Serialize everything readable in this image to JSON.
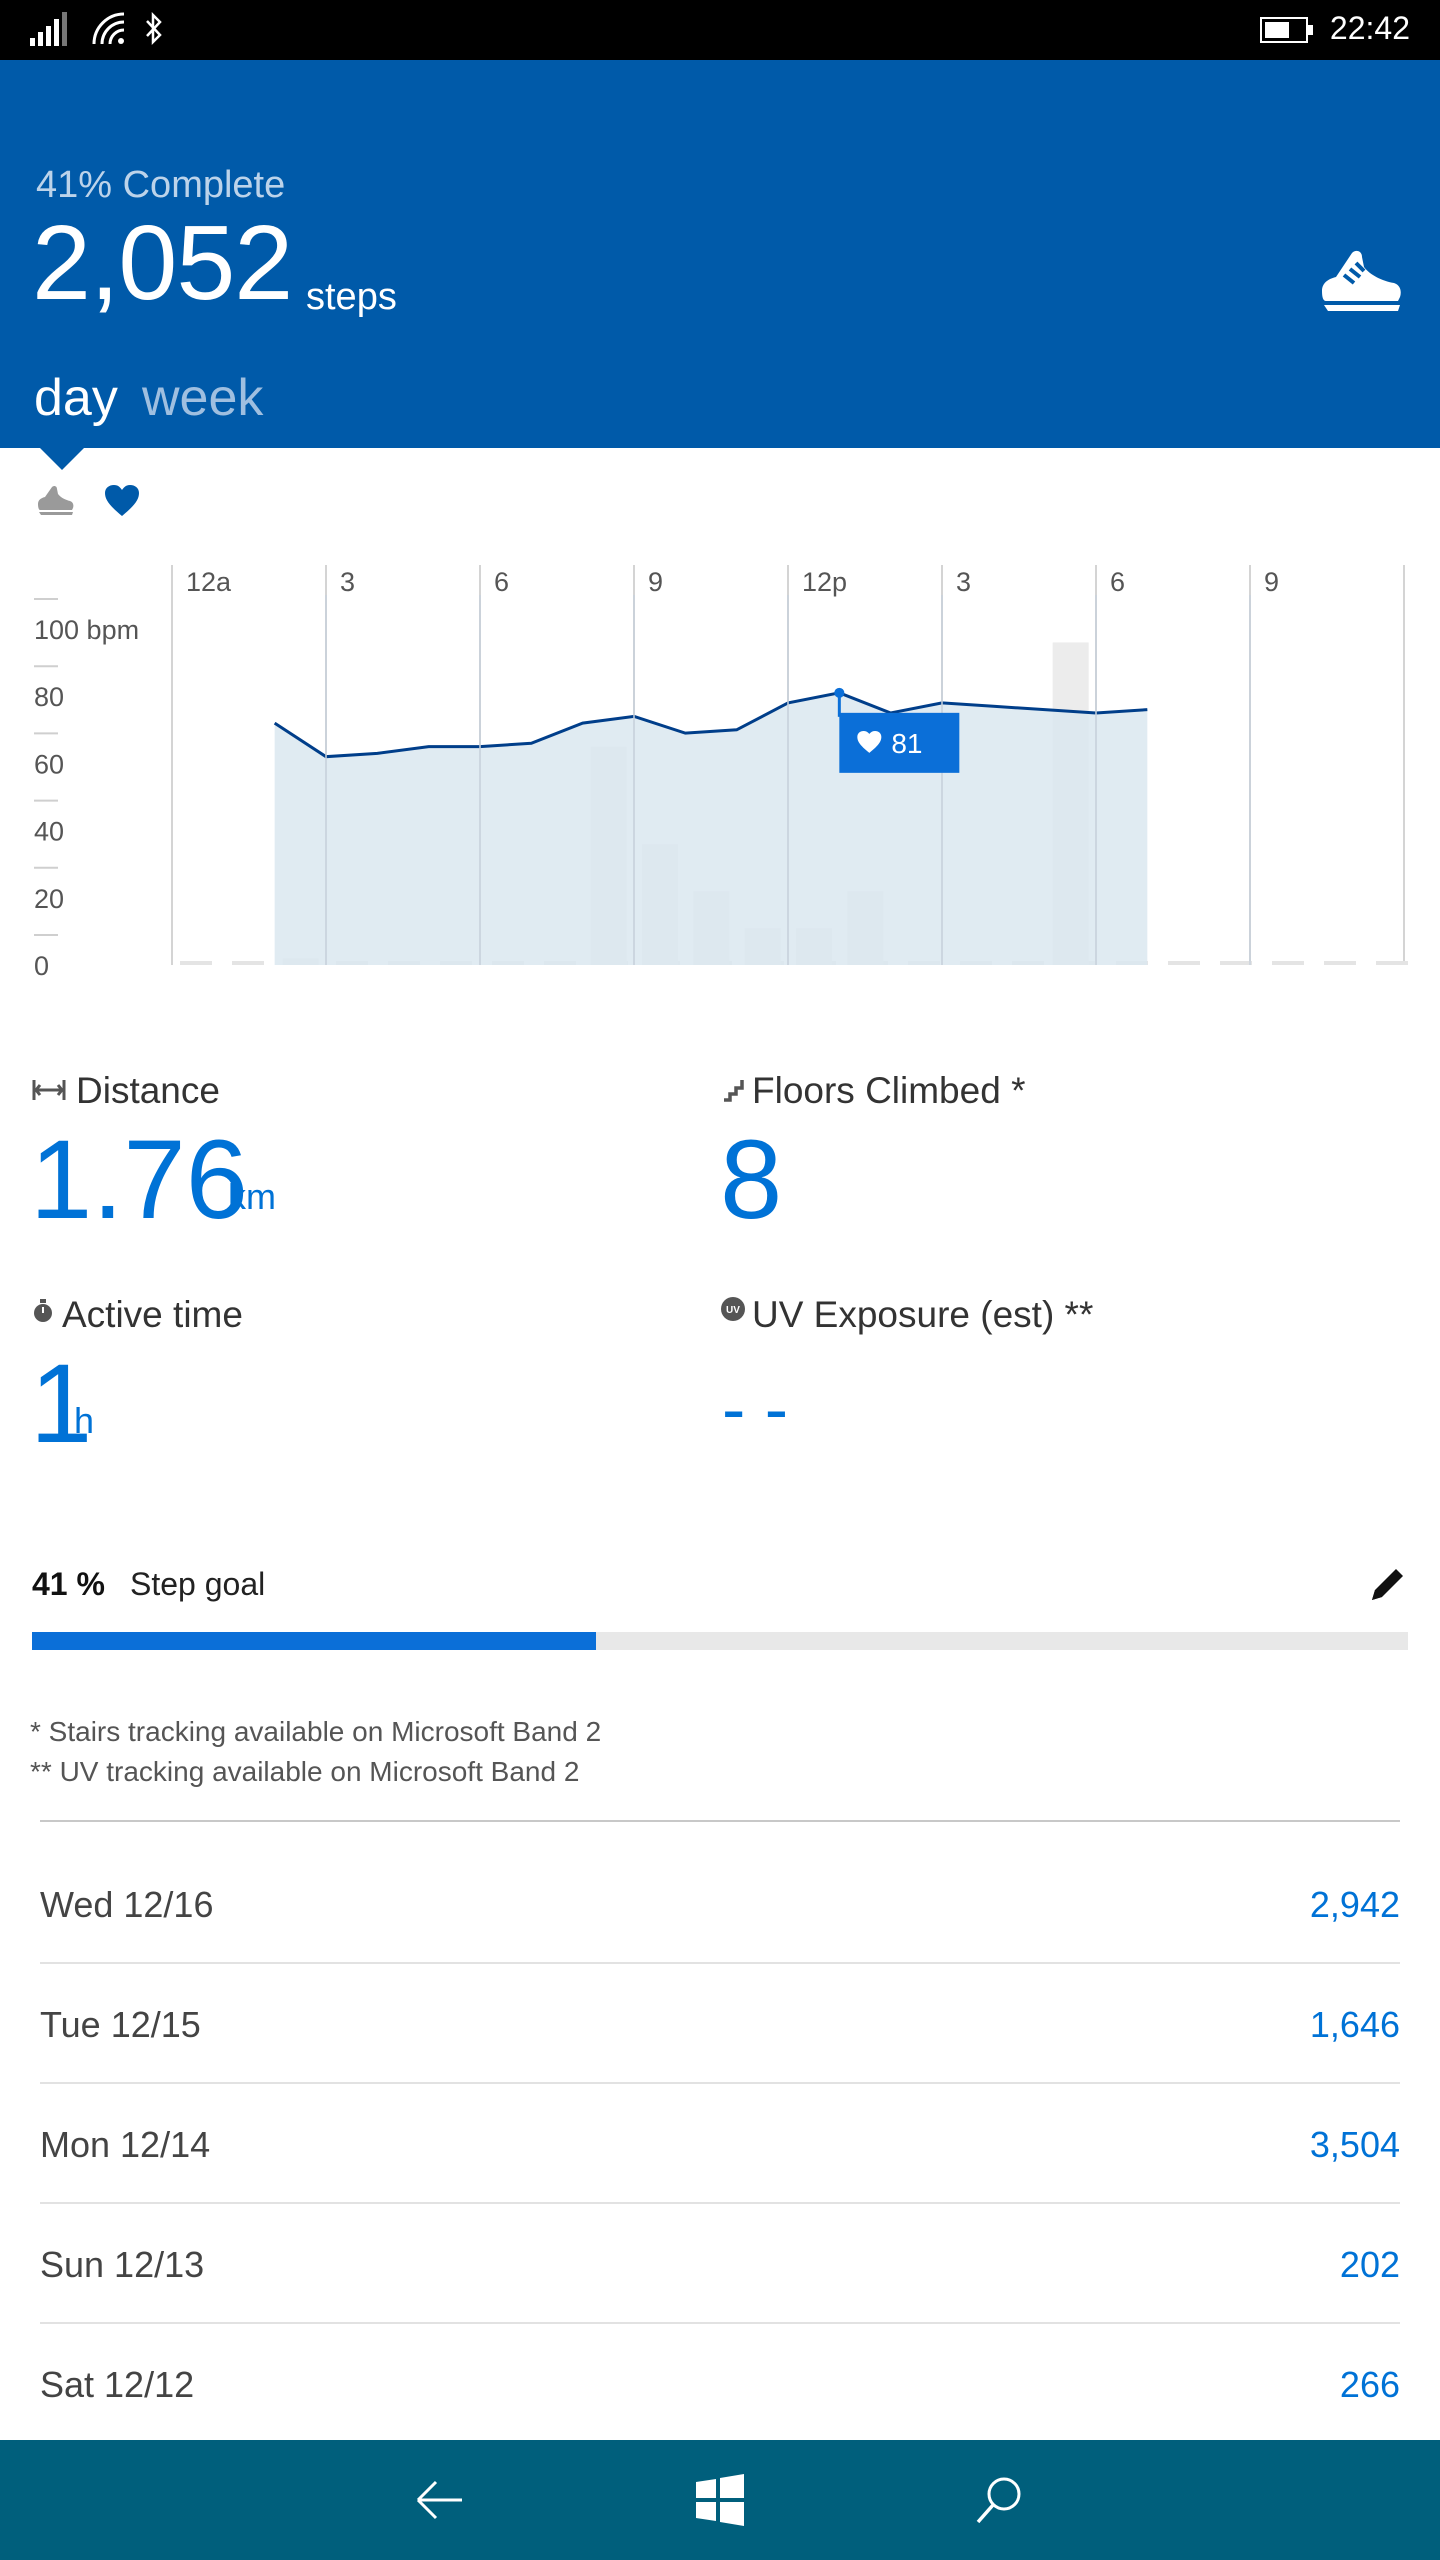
{
  "status_bar": {
    "time": "22:42",
    "icons": [
      "signal-icon",
      "wifi-icon",
      "bluetooth-icon",
      "battery-icon"
    ]
  },
  "header": {
    "percent_complete": "41% Complete",
    "steps_value": "2,052",
    "steps_unit": "steps",
    "tabs": [
      {
        "label": "day",
        "selected": true
      },
      {
        "label": "week",
        "selected": false
      }
    ],
    "icon": "running-shoe-icon",
    "background": "#005aa9"
  },
  "chart_toggle": {
    "options": [
      "steps-shoe-icon",
      "heart-icon"
    ],
    "selected": "heart-icon"
  },
  "chart_data": {
    "type": "line",
    "x_ticks": [
      "12a",
      "3",
      "6",
      "9",
      "12p",
      "3",
      "6",
      "9"
    ],
    "y_ticks": [
      "100 bpm",
      "80",
      "60",
      "40",
      "20",
      "0"
    ],
    "ylim": [
      0,
      100
    ],
    "xlim_hours": [
      0,
      24
    ],
    "series": [
      {
        "kind": "heart-rate-line",
        "x": [
          2,
          3,
          4,
          5,
          6,
          7,
          8,
          9,
          10,
          11,
          12,
          13,
          14,
          15,
          16,
          17,
          18,
          19
        ],
        "values": [
          72,
          62,
          63,
          65,
          65,
          66,
          72,
          74,
          69,
          70,
          78,
          81,
          75,
          78,
          77,
          76,
          75,
          76
        ]
      },
      {
        "kind": "step-bars",
        "x": [
          2,
          8,
          9,
          10,
          11,
          12,
          13,
          17
        ],
        "values": [
          2,
          65,
          36,
          22,
          11,
          11,
          22,
          96
        ]
      }
    ],
    "tooltip": {
      "icon": "heart-icon",
      "value": "81",
      "x": 13
    },
    "grid": true,
    "line_color": "#003e8a",
    "fill_color": "#dbe7f0"
  },
  "metrics": {
    "distance": {
      "label": "Distance",
      "value": "1.76",
      "unit": "km",
      "icon": "distance-icon"
    },
    "floors": {
      "label": "Floors Climbed *",
      "value": "8",
      "icon": "stairs-icon"
    },
    "active_time": {
      "label": "Active time",
      "value": "1",
      "unit": "h",
      "icon": "stopwatch-icon"
    },
    "uv": {
      "label": "UV Exposure (est) **",
      "value": "- -",
      "icon": "uv-icon"
    }
  },
  "goal": {
    "percent_label": "41 %",
    "label": "Step goal",
    "progress": 0.41,
    "icon": "pencil-icon"
  },
  "notes": [
    "* Stairs tracking available on Microsoft Band 2",
    "** UV tracking available on Microsoft Band 2"
  ],
  "history": [
    {
      "day": "Wed 12/16",
      "steps": "2,942"
    },
    {
      "day": "Tue 12/15",
      "steps": "1,646"
    },
    {
      "day": "Mon 12/14",
      "steps": "3,504"
    },
    {
      "day": "Sun 12/13",
      "steps": "202"
    },
    {
      "day": "Sat 12/12",
      "steps": "266"
    }
  ],
  "nav_bar": {
    "buttons": [
      "back-arrow-icon",
      "windows-logo-icon",
      "search-icon"
    ],
    "background": "#005f7c"
  }
}
